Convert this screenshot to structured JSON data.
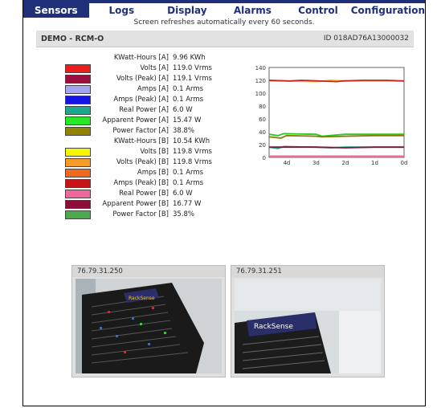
{
  "nav": {
    "tabs": [
      "Sensors",
      "Logs",
      "Display",
      "Alarms",
      "Control",
      "Configuration"
    ],
    "active_index": 0
  },
  "refresh_note": "Screen refreshes automatically every 60 seconds.",
  "device": {
    "name": "DEMO - RCM-O",
    "id": "ID 018AD76A13000032"
  },
  "readings": [
    {
      "label": "KWatt-Hours [A]",
      "value": "9.96 KWh",
      "color": ""
    },
    {
      "label": "Volts [A]",
      "value": "119.0 Vrms",
      "color": "#ee1c1c"
    },
    {
      "label": "Volts (Peak) [A]",
      "value": "119.1 Vrms",
      "color": "#9b0e3e"
    },
    {
      "label": "Amps [A]",
      "value": "0.1 Arms",
      "color": "#a4a4f4"
    },
    {
      "label": "Amps (Peak) [A]",
      "value": "0.1 Arms",
      "color": "#1414e6"
    },
    {
      "label": "Real Power [A]",
      "value": "6.0 W",
      "color": "#19a98c"
    },
    {
      "label": "Apparent Power [A]",
      "value": "15.47 W",
      "color": "#28e628"
    },
    {
      "label": "Power Factor [A]",
      "value": "38.8%",
      "color": "#918300"
    },
    {
      "label": "KWatt-Hours [B]",
      "value": "10.54 KWh",
      "color": ""
    },
    {
      "label": "Volts [B]",
      "value": "119.8 Vrms",
      "color": "#f6f600"
    },
    {
      "label": "Volts (Peak) [B]",
      "value": "119.8 Vrms",
      "color": "#f59b2c"
    },
    {
      "label": "Amps [B]",
      "value": "0.1 Arms",
      "color": "#f2691e"
    },
    {
      "label": "Amps (Peak) [B]",
      "value": "0.1 Arms",
      "color": "#c81414"
    },
    {
      "label": "Real Power [B]",
      "value": "6.0 W",
      "color": "#f0689a"
    },
    {
      "label": "Apparent Power [B]",
      "value": "16.77 W",
      "color": "#8e0e3a"
    },
    {
      "label": "Power Factor [B]",
      "value": "35.8%",
      "color": "#4caa4c"
    }
  ],
  "chart_data": {
    "type": "line",
    "xlabels": [
      "4d",
      "3d",
      "2d",
      "1d",
      "0d"
    ],
    "ylim": [
      0,
      140
    ],
    "yticks": [
      0,
      20,
      40,
      60,
      80,
      100,
      120,
      140
    ],
    "grid": false,
    "series": [
      {
        "color": "#f6c400",
        "x": [
          4.6,
          4,
          3,
          2.5,
          2,
          1,
          0
        ],
        "y": [
          119,
          119,
          118,
          120,
          119,
          119,
          119
        ]
      },
      {
        "color": "#cc2222",
        "x": [
          4.6,
          3.9,
          3.5,
          2.3,
          2.1,
          1.4,
          0.6,
          0
        ],
        "y": [
          120,
          119,
          120,
          118,
          119,
          120,
          120,
          119
        ]
      },
      {
        "color": "#28c828",
        "x": [
          4.6,
          4.3,
          4.1,
          3,
          2.8,
          2.3,
          2,
          1,
          0
        ],
        "y": [
          36,
          34,
          37,
          36,
          33,
          35,
          36,
          36,
          36
        ]
      },
      {
        "color": "#8a7a00",
        "x": [
          4.6,
          4.2,
          4,
          3,
          2.8,
          2,
          1,
          0
        ],
        "y": [
          32,
          30,
          34,
          33,
          32,
          33,
          34,
          34
        ]
      },
      {
        "color": "#19a98c",
        "x": [
          4.6,
          4.3,
          4.1,
          3,
          2.5,
          2,
          1,
          0
        ],
        "y": [
          16,
          14,
          17,
          16,
          15,
          16,
          16,
          16
        ]
      },
      {
        "color": "#8e0e3a",
        "x": [
          4.6,
          3,
          2,
          1,
          0
        ],
        "y": [
          16,
          16,
          15,
          16,
          16
        ]
      },
      {
        "color": "#f0689a",
        "x": [
          4.6,
          4,
          3,
          2,
          1,
          0
        ],
        "y": [
          2,
          2,
          2,
          2,
          2,
          2
        ]
      }
    ]
  },
  "cameras": [
    {
      "ip": "76.79.31.250"
    },
    {
      "ip": "76.79.31.251"
    }
  ],
  "camera_sign": "RackSense"
}
